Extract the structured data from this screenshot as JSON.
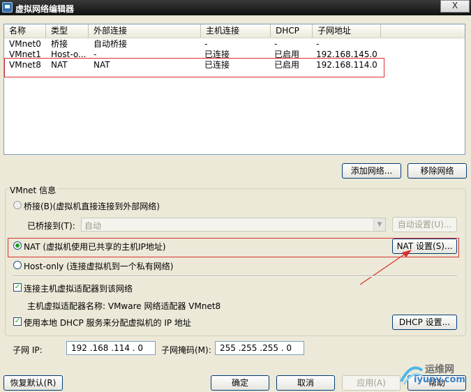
{
  "window": {
    "title": "虚拟网络编辑器",
    "close_label": "X"
  },
  "list": {
    "columns": [
      "名称",
      "类型",
      "外部连接",
      "主机连接",
      "DHCP",
      "子网地址"
    ],
    "rows": [
      [
        "VMnet0",
        "桥接",
        "自动桥接",
        "-",
        "-",
        "-"
      ],
      [
        "VMnet1",
        "Host-o...",
        "-",
        "已连接",
        "已启用",
        "192.168.145.0"
      ],
      [
        "VMnet8",
        "NAT",
        "NAT",
        "已连接",
        "已启用",
        "192.168.114.0"
      ]
    ]
  },
  "buttons": {
    "add_network": "添加网络...",
    "remove_network": "移除网络",
    "auto_settings": "自动设置(U)...",
    "nat_settings": "NAT 设置(S)...",
    "dhcp_settings": "DHCP 设置...",
    "restore_defaults": "恢复默认(R)",
    "ok": "确定",
    "cancel": "取消",
    "apply": "应用(A)",
    "help": "帮助"
  },
  "vmnet_info": {
    "group_title": "VMnet 信息",
    "bridge_radio": "桥接(B)(虚拟机直接连接到外部网络)",
    "bridged_to_label": "已桥接到(T):",
    "bridged_to_value": "自动",
    "nat_radio": "NAT (虚拟机使用已共享的主机IP地址)",
    "hostonly_radio": "Host-only (连接虚拟机到一个私有网络)",
    "connect_adapter_checkbox": "连接主机虚拟适配器到该网络",
    "adapter_name_text": "主机虚拟适配器名称: VMware 网络适配器 VMnet8",
    "dhcp_checkbox": "使用本地 DHCP 服务来分配虚拟机的 IP 地址",
    "selected_mode": "NAT"
  },
  "subnet": {
    "ip_label": "子网 IP:",
    "ip_value": "192 .168 .114 .  0",
    "mask_label": "子网掩码(M):",
    "mask_value": "255 .255 .255 .  0"
  },
  "watermark": {
    "line1": "运维网",
    "line2": "iyunv.com"
  },
  "colors": {
    "annotation": "#d93030",
    "titlebar": "#1a1a1a",
    "dialog_bg": "#ece9d8"
  }
}
